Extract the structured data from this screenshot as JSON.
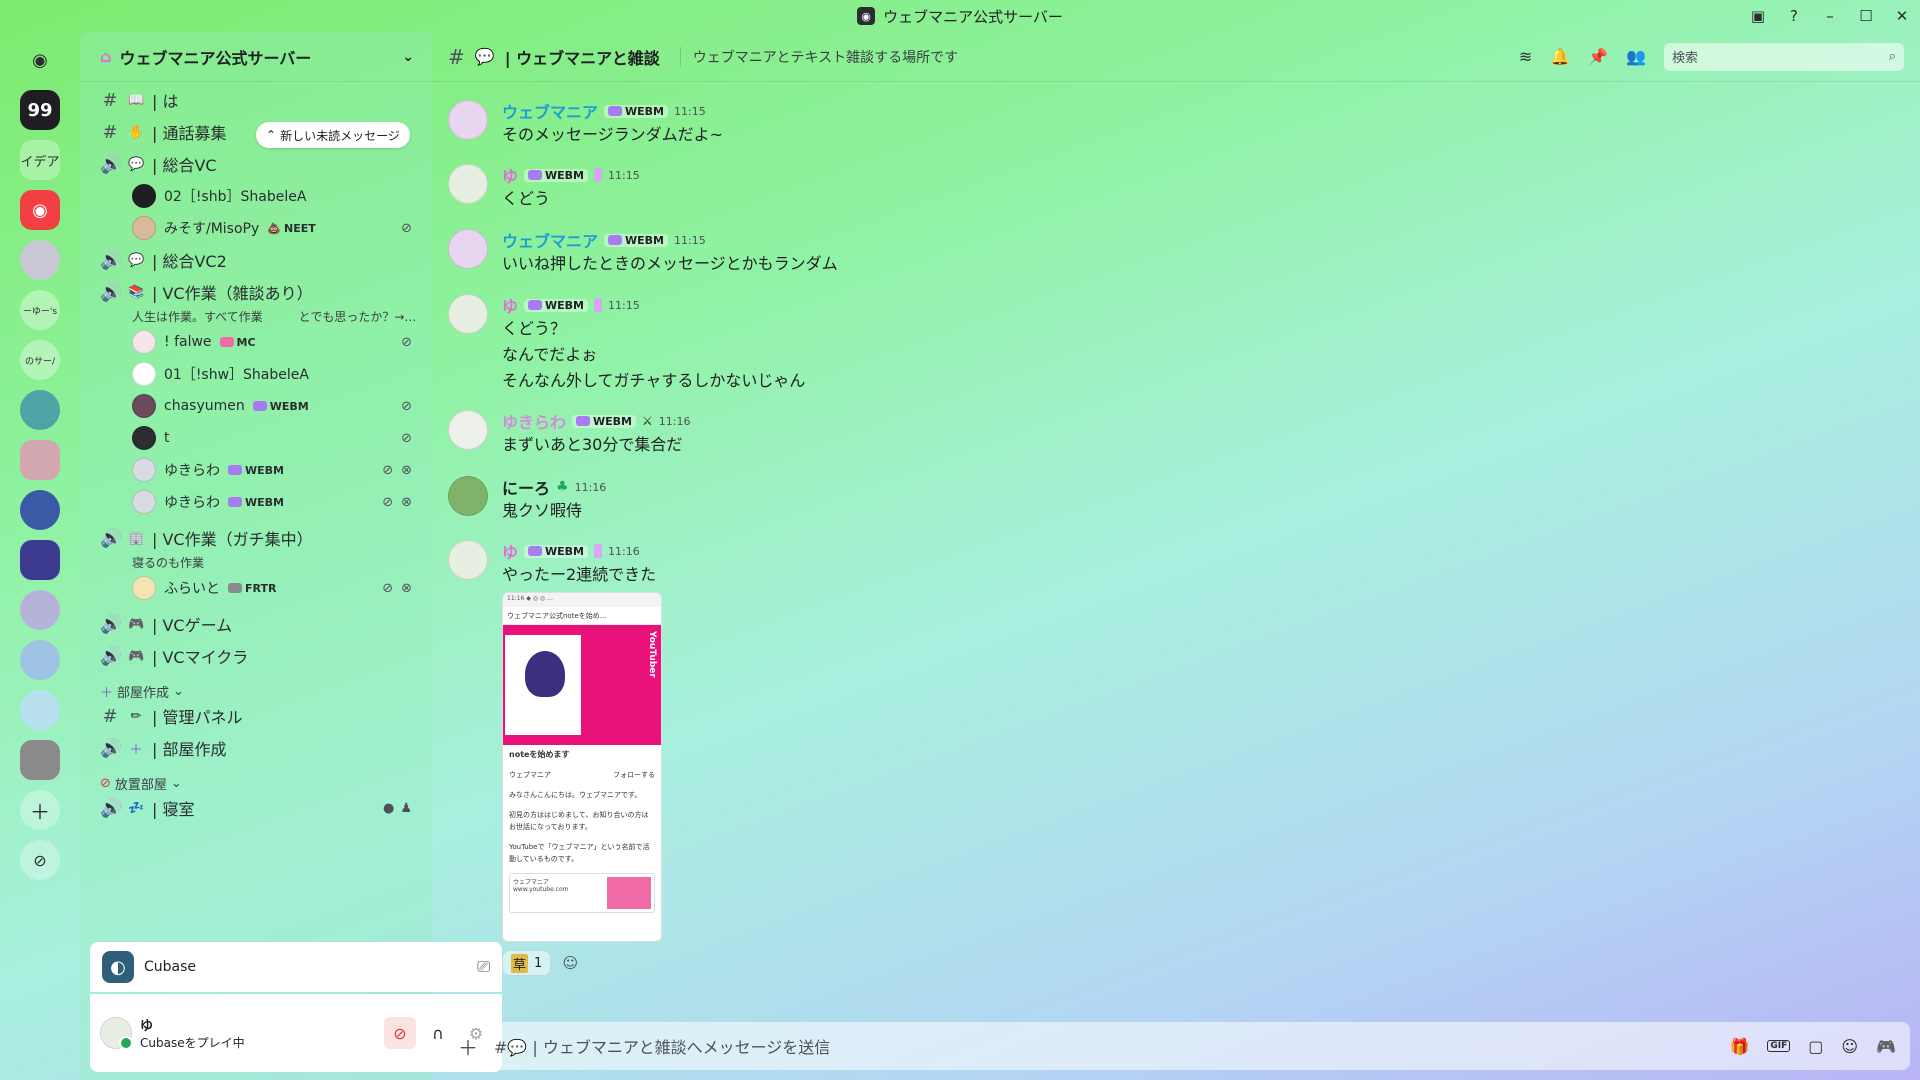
{
  "window": {
    "title": "ウェブマニア公式サーバー",
    "controls": [
      "inbox-icon",
      "help-icon",
      "minimize",
      "maximize",
      "close"
    ]
  },
  "rail": {
    "servers": [
      {
        "name": "discord-home",
        "color": "#5865f2"
      },
      {
        "name": "server-99",
        "color": "#1e1f22",
        "label": "99"
      },
      {
        "name": "server-idea",
        "label": "イデア"
      },
      {
        "name": "server-discord",
        "color": "#f23f43"
      },
      {
        "name": "server-girl",
        "color": "#c9c9d6"
      },
      {
        "name": "server-yu",
        "label": "ーゆー's"
      },
      {
        "name": "server-saba",
        "label": "のサー/"
      },
      {
        "name": "server-cat",
        "color": "#4ea3a6"
      },
      {
        "name": "server-manga",
        "color": "#d3a7b0"
      },
      {
        "name": "server-suit",
        "color": "#3a5aa6"
      },
      {
        "name": "server-anime1",
        "color": "#3b3a8f"
      },
      {
        "name": "server-anime2",
        "color": "#b6b3d8"
      },
      {
        "name": "server-anime3",
        "color": "#9fc4e3"
      },
      {
        "name": "server-building",
        "color": "#b9e0ef"
      },
      {
        "name": "server-glasses",
        "color": "#8a8a8a"
      }
    ]
  },
  "sidebar": {
    "server_name": "ウェブマニア公式サーバー",
    "new_unread": "新しい未読メッセージ",
    "channels": {
      "c1": "| は",
      "c2": "| 通話募集",
      "c3": "| 総合VC",
      "c4": "| 総合VC2",
      "c5": "| VC作業（雑談あり）",
      "c5_desc": "人生は作業。すべて作業　　　とでも思ったか？→…",
      "c6": "| VC作業（ガチ集中）",
      "c6_desc": "寝るのも作業",
      "c7": "| VCゲーム",
      "c8": "| VCマイクラ",
      "cat1": "部屋作成",
      "c9": "| 管理パネル",
      "c10": "| 部屋作成",
      "cat2": "放置部屋",
      "c11": "| 寝室"
    },
    "voice_users": {
      "u1": "02［!shb］ShabeleA",
      "u2": "みそす/MisoPy",
      "u2_tag": "NEET",
      "u3": "! falwe",
      "u3_tag": "MC",
      "u4": "01［!shw］ShabeleA",
      "u5": "chasyumen",
      "u5_tag": "WEBM",
      "u6": "t",
      "u7": "ゆきらわ",
      "u7_tag": "WEBM",
      "u8": "ゆきらわ",
      "u8_tag": "WEBM",
      "u9": "ふらいと",
      "u9_tag": "FRTR"
    }
  },
  "activity": {
    "app": "Cubase"
  },
  "user": {
    "name": "ゆ",
    "status": "Cubaseをプレイ中"
  },
  "channel": {
    "name": "| ウェブマニアと雑談",
    "topic": "ウェブマニアとテキスト雑談する場所です",
    "search_placeholder": "検索"
  },
  "messages": [
    {
      "author": "ウェブマニア",
      "author_color": "#1e9cd7",
      "tag": "WEBM",
      "time": "11:15",
      "lines": [
        "そのメッセージランダムだよ~"
      ]
    },
    {
      "author": "ゆ",
      "author_color": "#e06fd6",
      "tag": "WEBM",
      "time": "11:15",
      "lines": [
        "くどう"
      ]
    },
    {
      "author": "ウェブマニア",
      "author_color": "#1e9cd7",
      "tag": "WEBM",
      "time": "11:15",
      "lines": [
        "いいね押したときのメッセージとかもランダム"
      ]
    },
    {
      "author": "ゆ",
      "author_color": "#e06fd6",
      "tag": "WEBM",
      "time": "11:15",
      "lines": [
        "くどう？",
        "なんでだよぉ",
        "そんなん外してガチャするしかないじゃん"
      ]
    },
    {
      "author": "ゆきらわ",
      "author_color": "#d48be0",
      "tag": "WEBM",
      "time": "11:16",
      "lines": [
        "まずいあと30分で集合だ"
      ]
    },
    {
      "author": "にーろ",
      "author_color": "#1e1f22",
      "tag": "",
      "time": "11:16",
      "lines": [
        "鬼クソ暇侍"
      ]
    },
    {
      "author": "ゆ",
      "author_color": "#e06fd6",
      "tag": "WEBM",
      "time": "11:16",
      "lines": [
        "やったー2連続できた"
      ]
    }
  ],
  "attachment": {
    "bar": "11:16 ◆ ◎ ◎ …",
    "title": "ウェブマニア公式noteを始め...",
    "banner_text": "YouTuber",
    "heading": "noteを始めます",
    "author": "ウェブマニア",
    "follow": "フォローする",
    "body1": "みなさんこんにちは。ウェブマニアです。",
    "body2": "初見の方ははじめまして、お知り合いの方はお世話になっております。",
    "body3": "YouTubeで「ウェブマニア」という名前で活動しているものです。",
    "card_title": "ウェブマニア",
    "card_url": "www.youtube.com"
  },
  "reactions": {
    "emoji": "草",
    "count": "1"
  },
  "composer": {
    "placeholder": "#💬 | ウェブマニアと雑談へメッセージを送信"
  }
}
